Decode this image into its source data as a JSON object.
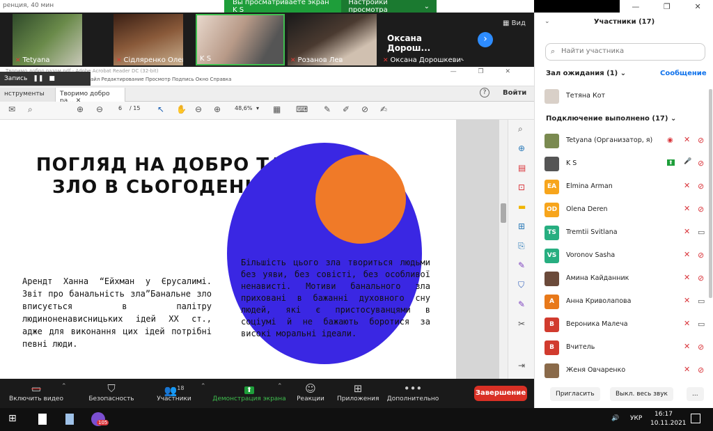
{
  "topbar": {
    "title_fragment": "ренция, 40 мин"
  },
  "banner": {
    "viewing": "Вы просматриваете экран K S",
    "settings": "Настройки просмотра",
    "settings_chevron": "⌄"
  },
  "window_controls": {
    "minimize": "—",
    "restore": "❐",
    "close": "✕"
  },
  "strip": {
    "tiles": [
      {
        "name": "Tetyana",
        "muted": true
      },
      {
        "name": "Сідляренко Олена",
        "muted": true
      },
      {
        "name": "K S",
        "muted": false
      },
      {
        "name": "Розанов Лев",
        "muted": true
      },
      {
        "name": "Оксана Дорошкевич",
        "big": "Оксана Дорош...",
        "muted": true
      }
    ],
    "next": "›",
    "view": "Вид",
    "mic_glyph": "✕"
  },
  "recording": {
    "label": "Запись",
    "pause": "❚❚",
    "stop": "■"
  },
  "acrobat": {
    "title": "Творимо добро разом.pdf - Adobe Acrobat Reader DC (32-bit)",
    "menu": "айл  Редактирование  Просмотр  Подпись  Окно  Справка",
    "wc": "— ❐ ✕",
    "tabs": [
      "нструменты",
      "Творимо добро ра..."
    ],
    "tab_close": "✕",
    "help": "?",
    "login": "Войти",
    "page_current": "6",
    "page_total": "/ 15",
    "zoom": "48,6%",
    "zoom_chevron": "▾",
    "icons": [
      "✉",
      "⌕",
      "⊕",
      "⊖",
      "↖",
      "✋",
      "⊖",
      "⊕",
      "▦",
      "⌨",
      "✎",
      "✐",
      "⊘",
      "✍"
    ],
    "right_icons": [
      "⌕",
      "⊕",
      "▤",
      "⊡",
      "▬",
      "⊞",
      "⎘",
      "✎",
      "⛉",
      "✎",
      "✂",
      "⇥"
    ]
  },
  "slide": {
    "headline_1": "ПОГЛЯД НА ДОБРО ТА",
    "headline_2": "ЗЛО В СЬОГОДЕННІ",
    "left_text": "Арендт Ханна “Ейхман у Єрусалимі. Звіт про банальність зла”Банальне зло вписується в палітру людиноненависницьких ідей XX ст., адже для виконання цих ідей потрібні певні люди.",
    "circle_text": "Більшість цього зла твориться людьми без уяви, без совісті, без особливої ненависті. Мотиви банального зла приховані в бажанні духовного сну людей, які є пристосуванцями в соціумі й не бажають боротися за високі моральні ідеали.",
    "colors": {
      "circle": "#3a27e3",
      "accent": "#f07a28"
    }
  },
  "controls": {
    "video": "Включить видео",
    "security": "Безопасность",
    "participants": "Участники",
    "participants_count": "18",
    "share": "Демонстрация экрана",
    "reactions": "Реакции",
    "apps": "Приложения",
    "more": "Дополнительно",
    "end": "Завершение",
    "chevron": "⌃",
    "icons": {
      "video": "▭",
      "security": "⛉",
      "participants": "👥",
      "share": "⬆",
      "reactions": "☺",
      "apps": "⊞",
      "more": "•••"
    }
  },
  "taskbar": {
    "start": "⊞",
    "lang": "УКР",
    "time": "16:17",
    "date": "10.11.2021",
    "badge": "105",
    "sound": "🔊"
  },
  "panel": {
    "title": "Участники (17)",
    "collapse": "⌄",
    "search_icon": "⌕",
    "search_placeholder": "Найти участника",
    "waiting": "Зал ожидания (1)",
    "waiting_chevron": "⌄",
    "message": "Сообщение",
    "waiting_person": "Тетяна Кот",
    "connected": "Подключение выполнено (17)",
    "participants": [
      {
        "name": "Tetyana (Организатор, я)",
        "initials": "",
        "color": "#7a8a50",
        "mic": "muted",
        "video": "off",
        "rec": true
      },
      {
        "name": "K S",
        "initials": "",
        "color": "#555555",
        "mic": "on",
        "video": "off",
        "share": true
      },
      {
        "name": "Elmina Arman",
        "initials": "EA",
        "color": "#f7a51c",
        "mic": "muted",
        "video": "off"
      },
      {
        "name": "Olena Deren",
        "initials": "OD",
        "color": "#f7a51c",
        "mic": "muted",
        "video": "off"
      },
      {
        "name": "Tremtii Svitlana",
        "initials": "TS",
        "color": "#27ae80",
        "mic": "muted",
        "video": "on"
      },
      {
        "name": "Voronov Sasha",
        "initials": "VS",
        "color": "#27ae80",
        "mic": "muted",
        "video": "off"
      },
      {
        "name": "Амина Кайданник",
        "initials": "",
        "color": "#6b4a3a",
        "mic": "muted",
        "video": "off"
      },
      {
        "name": "Анна Криволапова",
        "initials": "А",
        "color": "#e8791a",
        "mic": "muted",
        "video": "on"
      },
      {
        "name": "Вероника Малеча",
        "initials": "В",
        "color": "#d13b2e",
        "mic": "muted",
        "video": "on"
      },
      {
        "name": "Вчитель",
        "initials": "В",
        "color": "#d13b2e",
        "mic": "muted",
        "video": "off"
      },
      {
        "name": "Женя Овчаренко",
        "initials": "",
        "color": "#8a6a4a",
        "mic": "muted",
        "video": "off"
      }
    ],
    "invite": "Пригласить",
    "mute_all": "Выкл. весь звук",
    "more": "..."
  },
  "icon_glyphs": {
    "mic_muted": "✕",
    "mic_on": "🎤",
    "video_off": "⊘",
    "video_on": "▭",
    "share": "⬆",
    "rec": "◉"
  }
}
